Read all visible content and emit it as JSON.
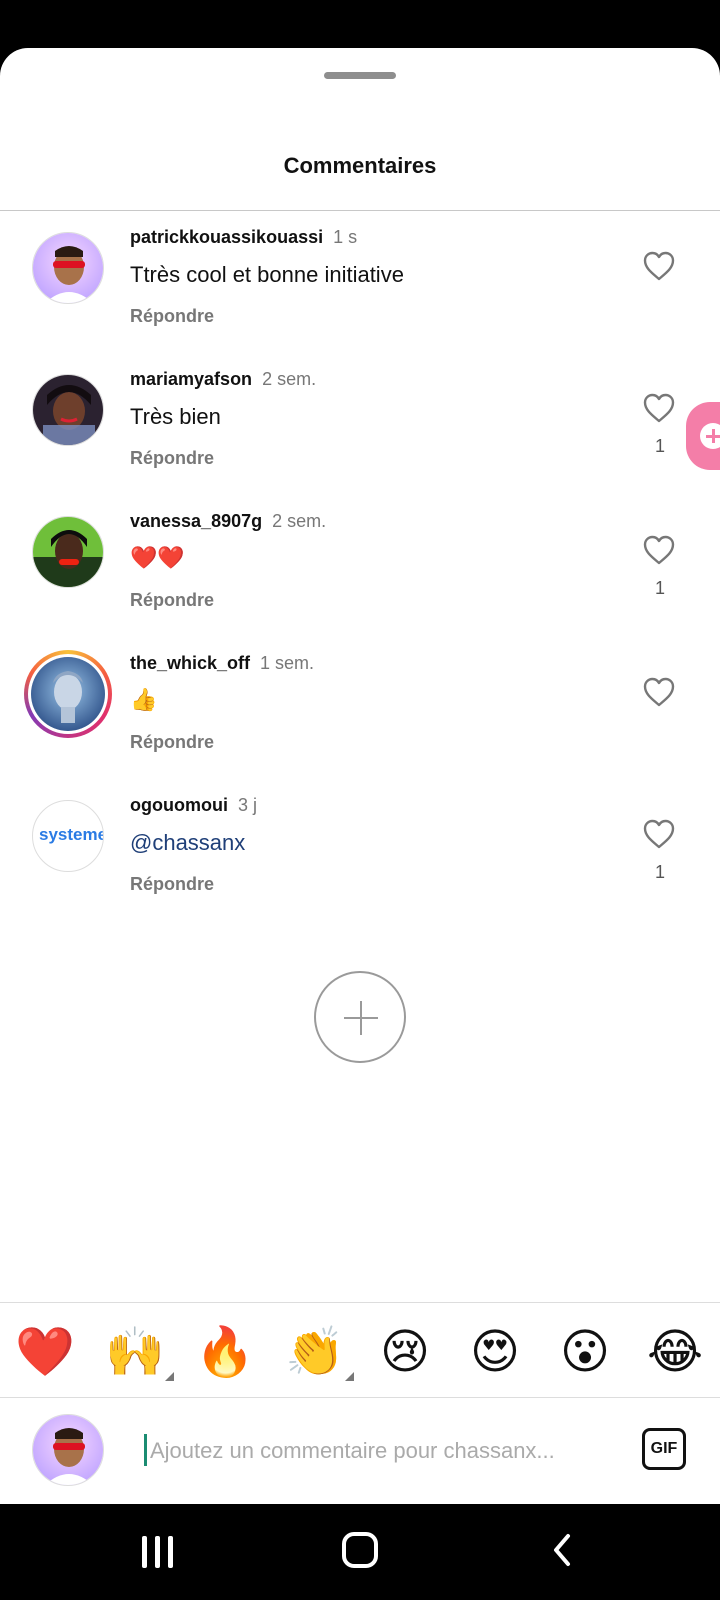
{
  "sheet": {
    "title": "Commentaires"
  },
  "comments": [
    {
      "username": "patrickkouassikouassi",
      "time": "1 s",
      "text": "Ttrès cool et bonne initiative",
      "reply": "Répondre",
      "likes": ""
    },
    {
      "username": "mariamyafson",
      "time": "2 sem.",
      "text": "Très bien",
      "reply": "Répondre",
      "likes": "1"
    },
    {
      "username": "vanessa_8907g",
      "time": "2 sem.",
      "text": "❤️❤️",
      "reply": "Répondre",
      "likes": "1"
    },
    {
      "username": "the_whick_off",
      "time": "1 sem.",
      "text": "👍",
      "reply": "Répondre",
      "likes": ""
    },
    {
      "username": "ogouomoui",
      "time": "3 j",
      "text": "@chassanx",
      "reply": "Répondre",
      "likes": "1",
      "avatar_text": "systeme"
    }
  ],
  "emoji_bar": [
    "❤️",
    "🙌",
    "🔥",
    "👏",
    "😢",
    "😍",
    "😮",
    "😂"
  ],
  "composer": {
    "placeholder": "Ajoutez un commentaire pour chassanx...",
    "gif_label": "GIF"
  },
  "colors": {
    "accent_pink": "#f47ea8",
    "mention": "#1f3f78",
    "secondary_text": "#777777"
  },
  "icons": [
    "heart-icon",
    "add-icon",
    "gif-icon",
    "recent-apps-icon",
    "home-icon",
    "back-icon"
  ]
}
